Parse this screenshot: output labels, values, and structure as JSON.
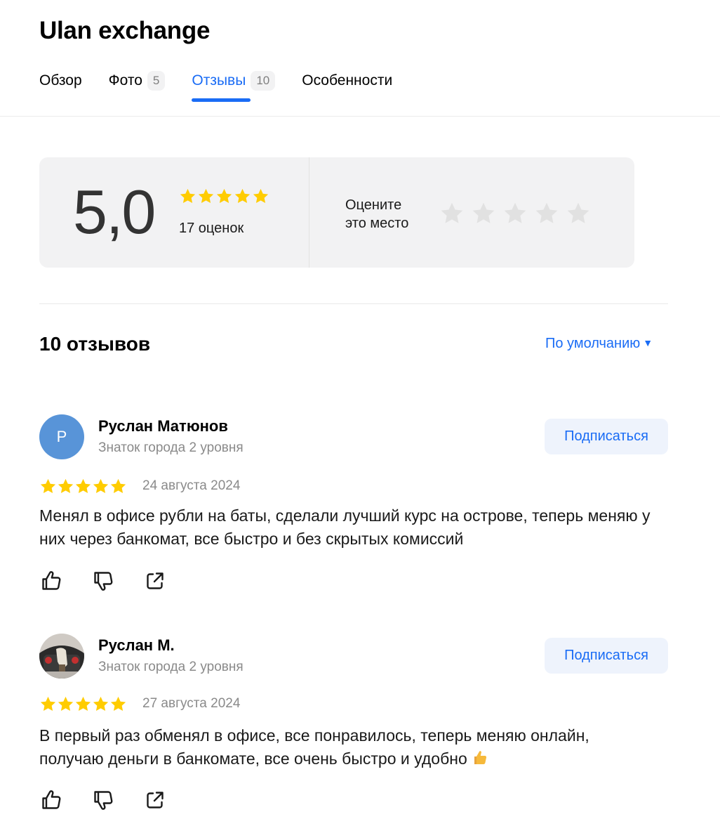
{
  "place": {
    "title": "Ulan exchange"
  },
  "tabs": [
    {
      "label": "Обзор",
      "count": null
    },
    {
      "label": "Фото",
      "count": "5"
    },
    {
      "label": "Отзывы",
      "count": "10"
    },
    {
      "label": "Особенности",
      "count": null
    }
  ],
  "rating": {
    "score": "5,0",
    "stars": 5,
    "count_label": "17 оценок",
    "rate_prompt_line1": "Оцените",
    "rate_prompt_line2": "это место"
  },
  "reviews_section": {
    "heading": "10 отзывов",
    "sort_label": "По умолчанию"
  },
  "reviews": [
    {
      "avatar_letter": "Р",
      "avatar_color": "#5894d8",
      "author": "Руслан Матюнов",
      "level": "Знаток города 2 уровня",
      "subscribe_label": "Подписаться",
      "stars": 5,
      "date": "24 августа 2024",
      "text": "Менял в офисе рубли на баты, сделали лучший курс на острове, теперь меняю у них через банкомат, все быстро и без скрытых комиссий"
    },
    {
      "avatar_letter": "",
      "author": "Руслан М.",
      "level": "Знаток города 2 уровня",
      "subscribe_label": "Подписаться",
      "stars": 5,
      "date": "27 августа 2024",
      "text": "В первый раз обменял в офисе, все понравилось, теперь меняю онлайн, получаю деньги в банкомате, все очень быстро и удобно",
      "trailing_emoji": "thumbs-up-emoji"
    }
  ],
  "icons": {
    "star_filled_color": "#ffcc00",
    "star_empty_color": "#e1e1e1",
    "accent": "#1a6cf5",
    "like": "thumbs-up-icon",
    "dislike": "thumbs-down-icon",
    "share": "share-icon"
  }
}
